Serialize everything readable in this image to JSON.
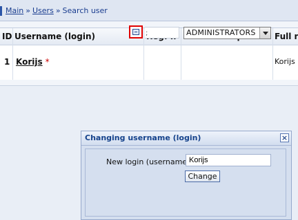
{
  "breadcrumb": {
    "items": [
      "Main",
      "Users"
    ],
    "separator": "»",
    "current": "Search user"
  },
  "table": {
    "headers": [
      "ID",
      "Username (login)",
      "Reg. IP",
      "Group",
      "Full n"
    ],
    "row": {
      "id": "1",
      "username": "Korijs",
      "star": "*",
      "ip": ";",
      "group": "ADMINISTRATORS",
      "fullname": "Korijs"
    }
  },
  "dialog": {
    "title": "Changing username (login)",
    "close_icon": "×",
    "label": "New login (username):",
    "input_value": "Korijs",
    "button": "Change"
  },
  "colors": {
    "link": "#1a3d8f",
    "highlight": "#e00000",
    "dialog_bg": "#d5dfef"
  }
}
